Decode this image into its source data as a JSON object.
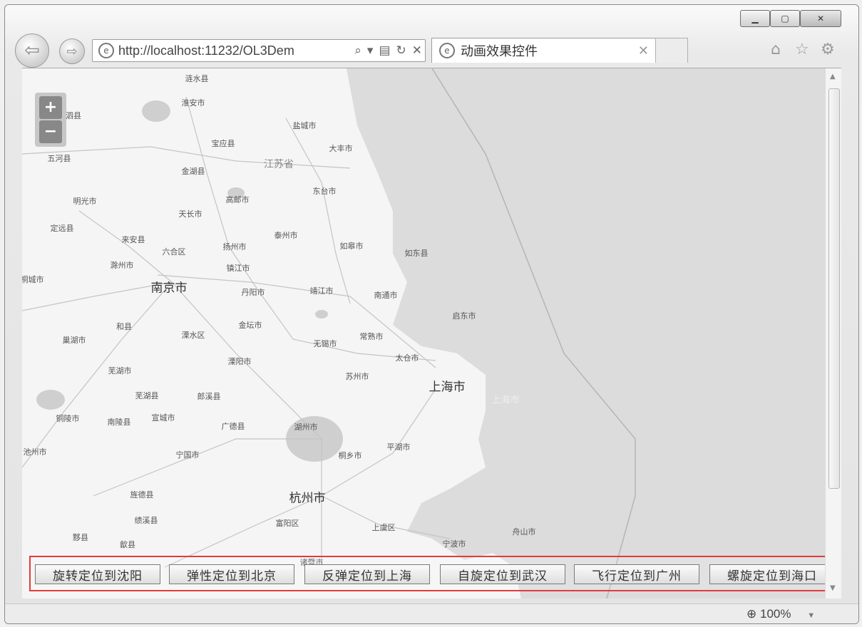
{
  "browser": {
    "url": "http://localhost:11232/OL3Dem",
    "tab_title": "动画效果控件",
    "zoom_level": "100%"
  },
  "map": {
    "cities": [
      {
        "name": "涟水县"
      },
      {
        "name": "淮安市"
      },
      {
        "name": "泗县"
      },
      {
        "name": "盐城市"
      },
      {
        "name": "宝应县"
      },
      {
        "name": "大丰市"
      },
      {
        "name": "江苏省"
      },
      {
        "name": "五河县"
      },
      {
        "name": "金湖县"
      },
      {
        "name": "东台市"
      },
      {
        "name": "明光市"
      },
      {
        "name": "高邮市"
      },
      {
        "name": "天长市"
      },
      {
        "name": "定远县"
      },
      {
        "name": "来安县"
      },
      {
        "name": "泰州市"
      },
      {
        "name": "扬州市"
      },
      {
        "name": "如皋市"
      },
      {
        "name": "如东县"
      },
      {
        "name": "六合区"
      },
      {
        "name": "滁州市"
      },
      {
        "name": "镇江市"
      },
      {
        "name": "南京市"
      },
      {
        "name": "丹阳市"
      },
      {
        "name": "靖江市"
      },
      {
        "name": "南通市"
      },
      {
        "name": "启东市"
      },
      {
        "name": "和县"
      },
      {
        "name": "金坛市"
      },
      {
        "name": "巢湖市"
      },
      {
        "name": "溧水区"
      },
      {
        "name": "无锡市"
      },
      {
        "name": "常熟市"
      },
      {
        "name": "太仓市"
      },
      {
        "name": "溧阳市"
      },
      {
        "name": "芜湖市"
      },
      {
        "name": "苏州市"
      },
      {
        "name": "上海市"
      },
      {
        "name": "上海市"
      },
      {
        "name": "芜湖县"
      },
      {
        "name": "郎溪县"
      },
      {
        "name": "铜陵市"
      },
      {
        "name": "南陵县"
      },
      {
        "name": "宣城市"
      },
      {
        "name": "广德县"
      },
      {
        "name": "湖州市"
      },
      {
        "name": "宁国市"
      },
      {
        "name": "桐乡市"
      },
      {
        "name": "平湖市"
      },
      {
        "name": "旌德县"
      },
      {
        "name": "杭州市"
      },
      {
        "name": "绩溪县"
      },
      {
        "name": "富阳区"
      },
      {
        "name": "上虞区"
      },
      {
        "name": "舟山市"
      },
      {
        "name": "黟县"
      },
      {
        "name": "歙县"
      },
      {
        "name": "宁波市"
      },
      {
        "name": "诸暨市"
      },
      {
        "name": "池州市"
      },
      {
        "name": "桐城市"
      }
    ]
  },
  "controls": {
    "zoom_in": "+",
    "zoom_out": "−",
    "buttons": [
      {
        "label": "旋转定位到沈阳"
      },
      {
        "label": "弹性定位到北京"
      },
      {
        "label": "反弹定位到上海"
      },
      {
        "label": "自旋定位到武汉"
      },
      {
        "label": "飞行定位到广州"
      },
      {
        "label": "螺旋定位到海口"
      }
    ]
  },
  "icons": {
    "back": "back-arrow-icon",
    "forward": "forward-arrow-icon",
    "search": "search-icon",
    "refresh": "refresh-icon",
    "stop": "stop-icon",
    "home": "home-icon",
    "favorites": "star-icon",
    "settings": "gear-icon"
  },
  "colors": {
    "sea": "#dcdcdc",
    "land": "#f5f5f5",
    "highlight_border": "#e23b3b"
  }
}
